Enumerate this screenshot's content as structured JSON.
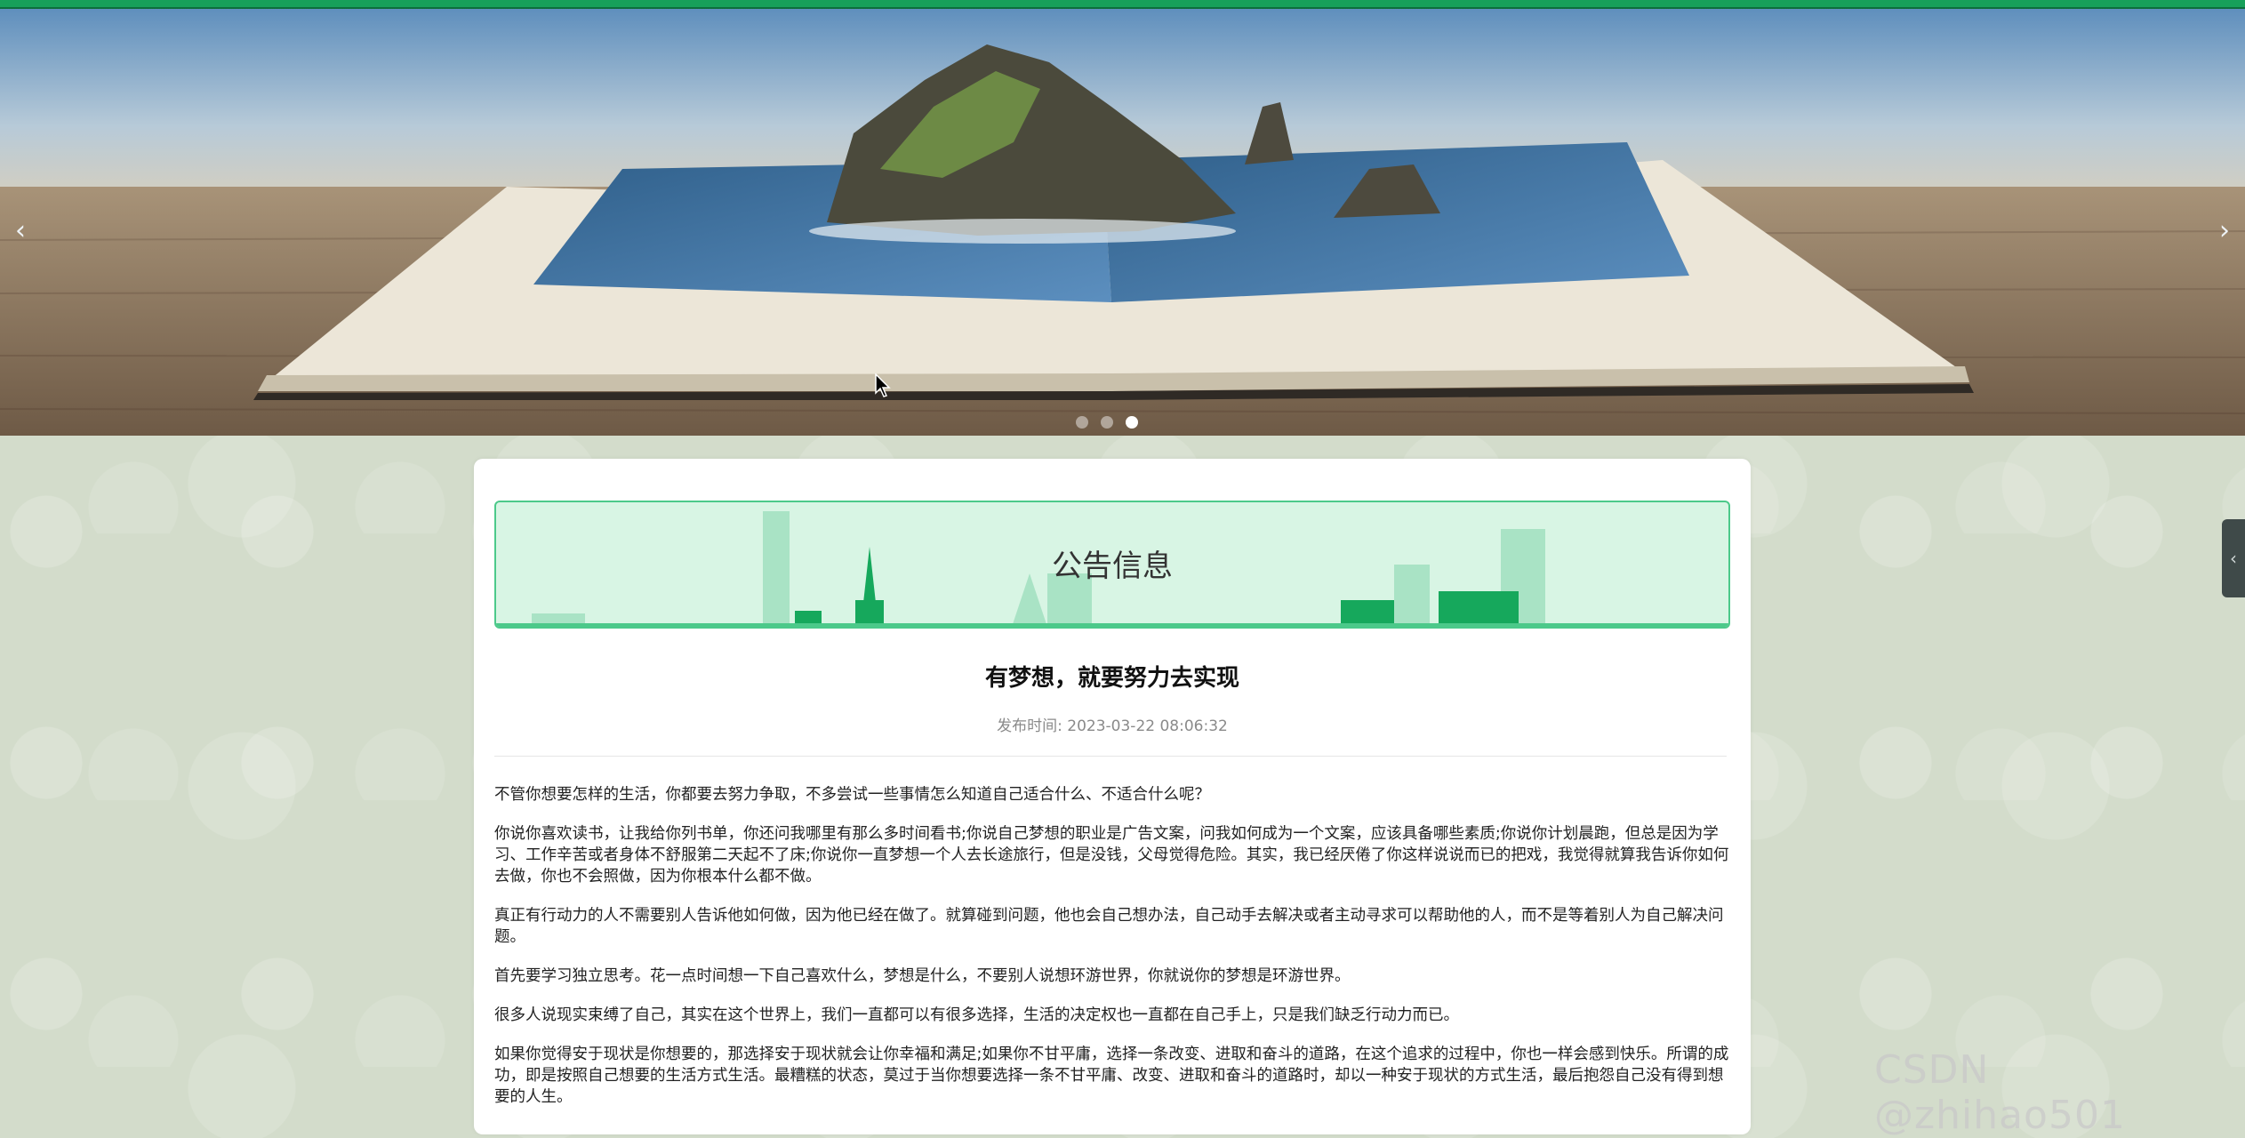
{
  "carousel": {
    "prev_symbol": "‹",
    "next_symbol": "›",
    "slide_count": 3,
    "active_slide": 3
  },
  "side_tab": {
    "symbol": "‹"
  },
  "section": {
    "title": "公告信息"
  },
  "article": {
    "title": "有梦想，就要努力去实现",
    "publish_label": "发布时间:",
    "publish_time": "2023-03-22 08:06:32",
    "paragraphs": [
      "不管你想要怎样的生活，你都要去努力争取，不多尝试一些事情怎么知道自己适合什么、不适合什么呢？",
      "你说你喜欢读书，让我给你列书单，你还问我哪里有那么多时间看书;你说自己梦想的职业是广告文案，问我如何成为一个文案，应该具备哪些素质;你说你计划晨跑，但总是因为学习、工作辛苦或者身体不舒服第二天起不了床;你说你一直梦想一个人去长途旅行，但是没钱，父母觉得危险。其实，我已经厌倦了你这样说说而已的把戏，我觉得就算我告诉你如何去做，你也不会照做，因为你根本什么都不做。",
      "真正有行动力的人不需要别人告诉他如何做，因为他已经在做了。就算碰到问题，他也会自己想办法，自己动手去解决或者主动寻求可以帮助他的人，而不是等着别人为自己解决问题。",
      "首先要学习独立思考。花一点时间想一下自己喜欢什么，梦想是什么，不要别人说想环游世界，你就说你的梦想是环游世界。",
      "很多人说现实束缚了自己，其实在这个世界上，我们一直都可以有很多选择，生活的决定权也一直都在自己手上，只是我们缺乏行动力而已。",
      "如果你觉得安于现状是你想要的，那选择安于现状就会让你幸福和满足;如果你不甘平庸，选择一条改变、进取和奋斗的道路，在这个追求的过程中，你也一样会感到快乐。所谓的成功，即是按照自己想要的生活方式生活。最糟糕的状态，莫过于当你想要选择一条不甘平庸、改变、进取和奋斗的道路时，却以一种安于现状的方式生活，最后抱怨自己没有得到想要的人生。"
    ]
  },
  "watermark": {
    "text": "CSDN @zhihao501"
  },
  "colors": {
    "accent": "#17a05a",
    "header_bg": "#d8f5e4",
    "header_border": "#4cc98a",
    "page_bg": "#d3dccb"
  }
}
